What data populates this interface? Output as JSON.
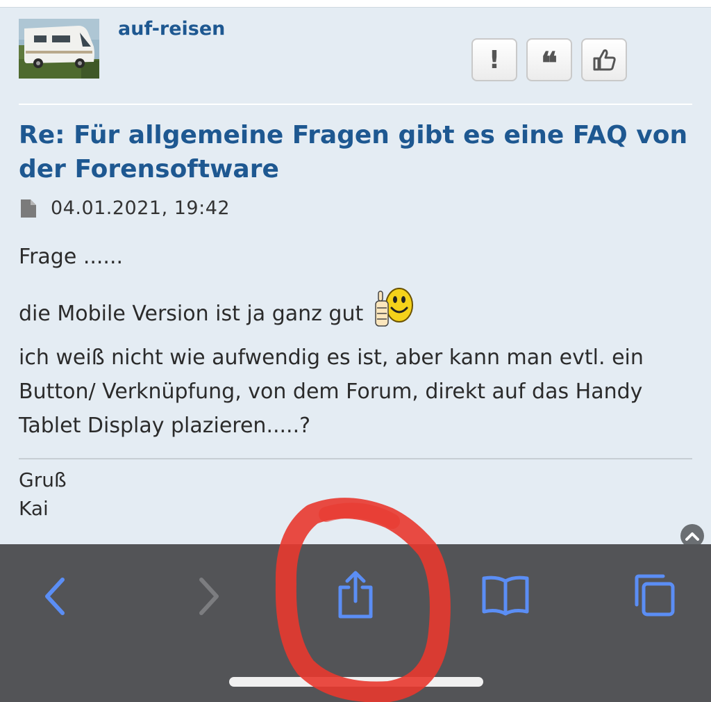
{
  "post": {
    "username": "auf-reisen",
    "title": "Re: Für allgemeine Fragen gibt es eine FAQ von der Forensoftware",
    "date": "04.01.2021, 19:42",
    "body_line1": "Frage ......",
    "body_line2": "die Mobile Version ist ja ganz gut",
    "body_line3": "ich weiß nicht wie aufwendig es ist, aber kann man evtl. ein Button/ Verknüpfung, von dem Forum, direkt auf das Handy Tablet Display plazieren.....?",
    "signature_line1": "Gruß",
    "signature_line2": "Kai"
  },
  "post_actions": {
    "report_glyph": "!",
    "quote_glyph": "❝",
    "icons": [
      "exclamation-icon",
      "quote-icon",
      "thumbs-up-icon"
    ]
  },
  "browser_toolbar": {
    "icons": [
      "back-icon",
      "forward-icon",
      "share-icon",
      "bookmarks-icon",
      "tabs-icon"
    ],
    "accent_color": "#5b8ef5",
    "disabled_color": "#7c7d80"
  },
  "colors": {
    "page_background": "#e4ecf3",
    "link_blue": "#1e5891",
    "toolbar_background": "#535457",
    "annotation_red": "#e8392f"
  }
}
